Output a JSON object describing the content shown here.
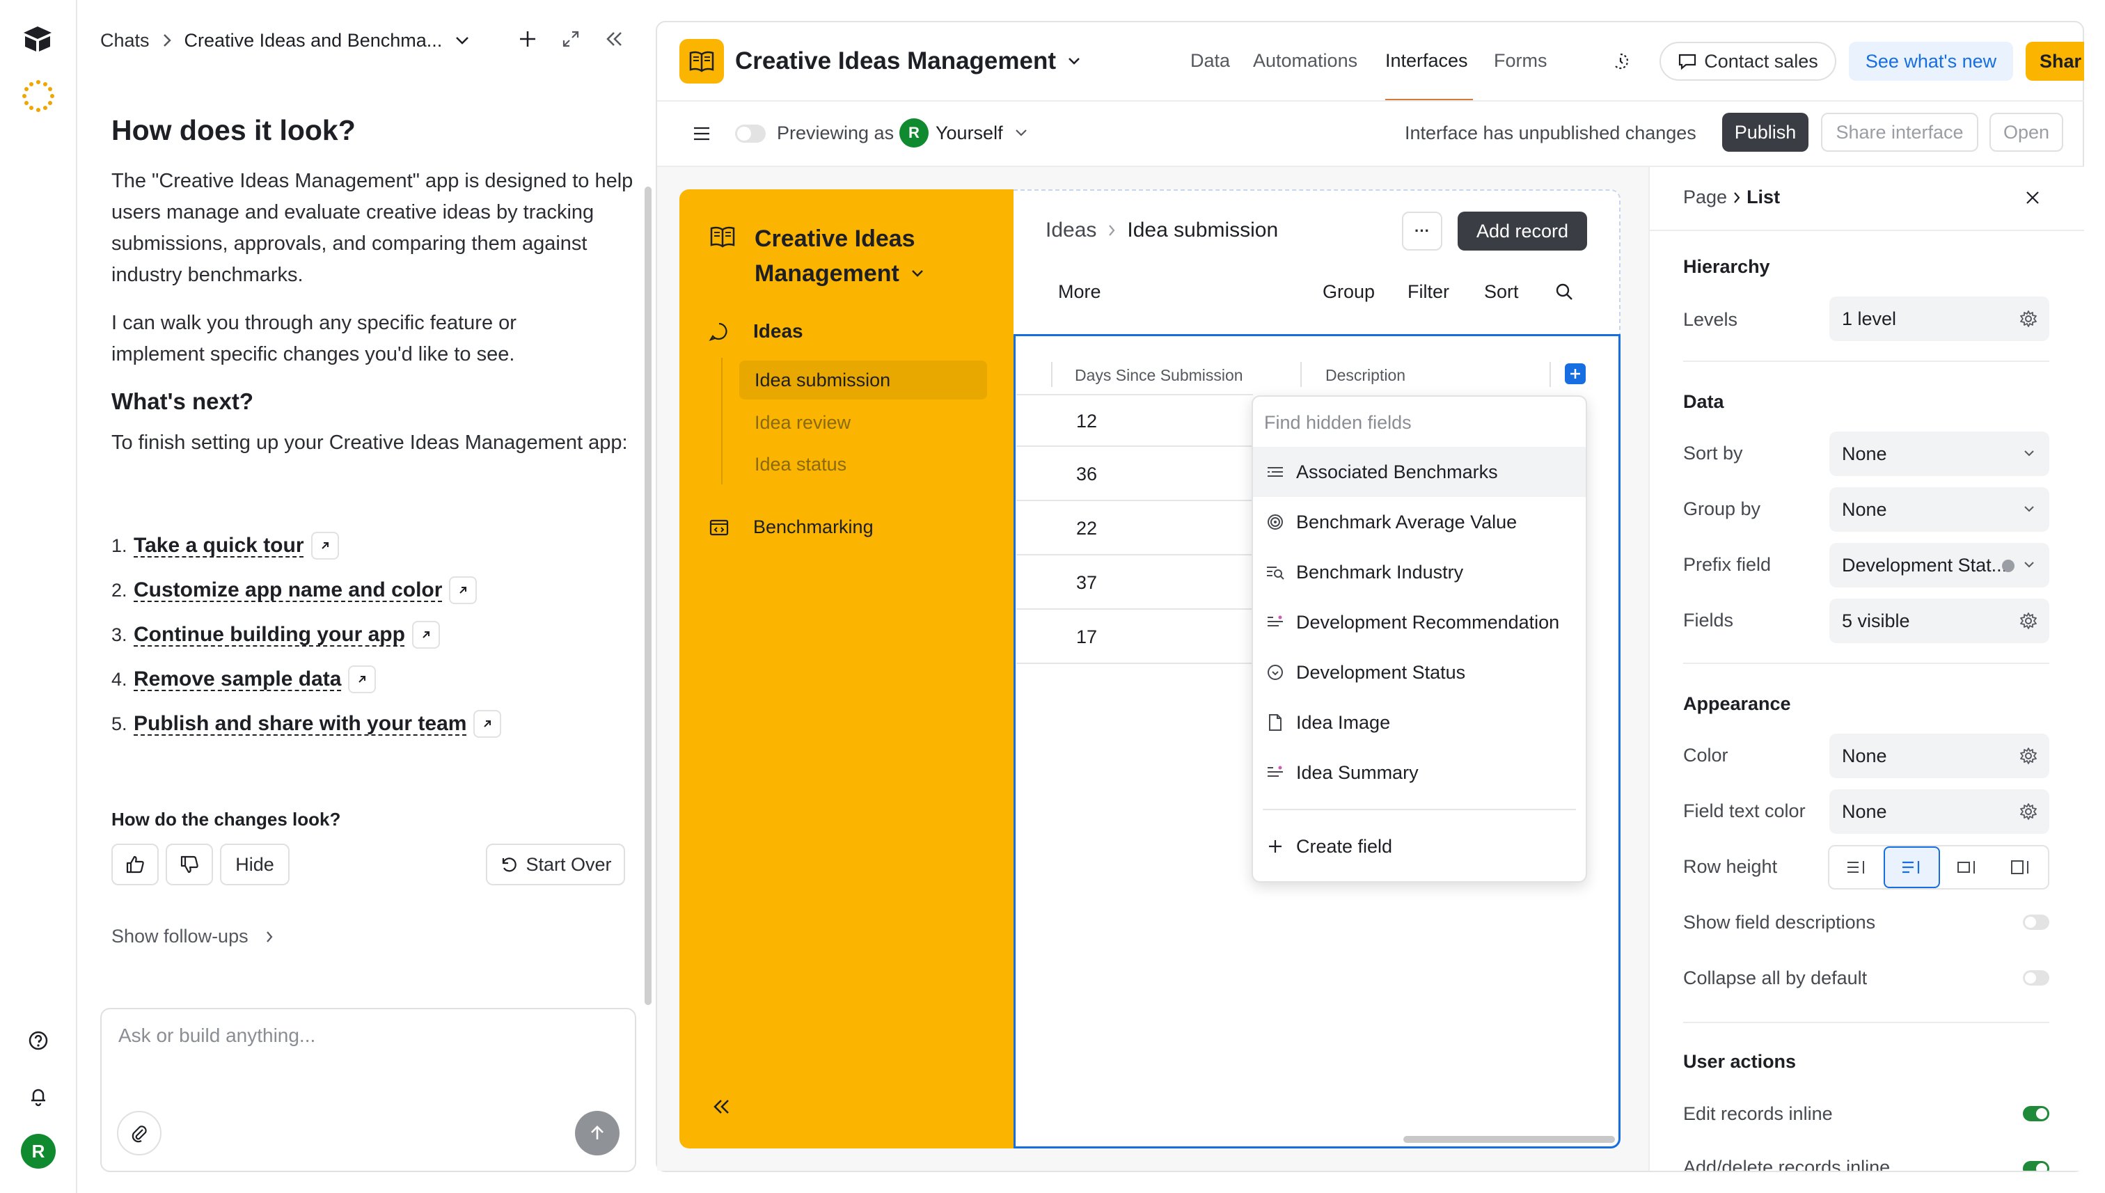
{
  "chat": {
    "breadcrumb_root": "Chats",
    "breadcrumb_current": "Creative Ideas and Benchma...",
    "heading_look": "How does it look?",
    "para1": "The \"Creative Ideas Management\" app is designed to help users manage and evaluate creative ideas by tracking submissions, approvals, and comparing them against industry benchmarks.",
    "para2": "I can walk you through any specific feature or implement specific changes you'd like to see.",
    "heading_next": "What's next?",
    "para3": "To finish setting up your Creative Ideas Management app:",
    "steps": [
      {
        "num": "1.",
        "label": "Take a quick tour"
      },
      {
        "num": "2.",
        "label": "Customize app name and color"
      },
      {
        "num": "3.",
        "label": "Continue building your app"
      },
      {
        "num": "4.",
        "label": "Remove sample data"
      },
      {
        "num": "5.",
        "label": "Publish and share with your team"
      }
    ],
    "feedback_question": "How do the changes look?",
    "hide_label": "Hide",
    "start_over_label": "Start Over",
    "followups_label": "Show follow-ups",
    "input_placeholder": "Ask or build anything...",
    "avatar_letter": "R"
  },
  "header": {
    "app_title": "Creative Ideas Management",
    "tabs": [
      "Data",
      "Automations",
      "Interfaces",
      "Forms"
    ],
    "active_tab": "Interfaces",
    "contact_sales": "Contact sales",
    "whats_new": "See what's new",
    "share": "Shar"
  },
  "toolbar": {
    "previewing_as": "Previewing as",
    "user_initial": "R",
    "user": "Yourself",
    "unpublished": "Interface has unpublished changes",
    "publish": "Publish",
    "share_interface": "Share interface",
    "open": "Open"
  },
  "app_sidebar": {
    "title_line1": "Creative Ideas",
    "title_line2": "Management",
    "section_ideas": "Ideas",
    "pages": [
      "Idea submission",
      "Idea review",
      "Idea status"
    ],
    "section_bench": "Benchmarking"
  },
  "list_view": {
    "breadcrumb_root": "Ideas",
    "breadcrumb_current": "Idea submission",
    "more_button": "···",
    "add_record": "Add record",
    "more": "More",
    "group": "Group",
    "filter": "Filter",
    "sort": "Sort",
    "col1": "Days Since Submission",
    "col2": "Description",
    "values": [
      "12",
      "36",
      "22",
      "37",
      "17"
    ]
  },
  "hidden_fields": {
    "placeholder": "Find hidden fields",
    "items": [
      {
        "label": "Associated Benchmarks",
        "icon": "lookup-icon"
      },
      {
        "label": "Benchmark Average Value",
        "icon": "rollup-icon"
      },
      {
        "label": "Benchmark Industry",
        "icon": "lookup-search-icon"
      },
      {
        "label": "Development Recommendation",
        "icon": "ai-text-icon"
      },
      {
        "label": "Development Status",
        "icon": "status-icon"
      },
      {
        "label": "Idea Image",
        "icon": "attachment-icon"
      },
      {
        "label": "Idea Summary",
        "icon": "ai-text-icon"
      }
    ],
    "create_field": "Create field"
  },
  "properties": {
    "crumb_root": "Page",
    "crumb_current": "List",
    "hierarchy": "Hierarchy",
    "levels_label": "Levels",
    "levels_value": "1 level",
    "data": "Data",
    "sort_label": "Sort by",
    "sort_value": "None",
    "group_label": "Group by",
    "group_value": "None",
    "prefix_label": "Prefix field",
    "prefix_value": "Development Stat...",
    "fields_label": "Fields",
    "fields_value": "5 visible",
    "appearance": "Appearance",
    "color_label": "Color",
    "color_value": "None",
    "ftc_label": "Field text color",
    "ftc_value": "None",
    "rowheight_label": "Row height",
    "show_desc": "Show field descriptions",
    "collapse": "Collapse all by default",
    "user_actions": "User actions",
    "edit_inline": "Edit records inline",
    "add_delete": "Add/delete records inline"
  },
  "colors": {
    "accent_yellow": "#fbb400",
    "accent_blue": "#166ee1",
    "publish_dark": "#3a3d44",
    "avatar_green": "#0f8a2e",
    "active_tab_underline": "#d47b3b"
  }
}
